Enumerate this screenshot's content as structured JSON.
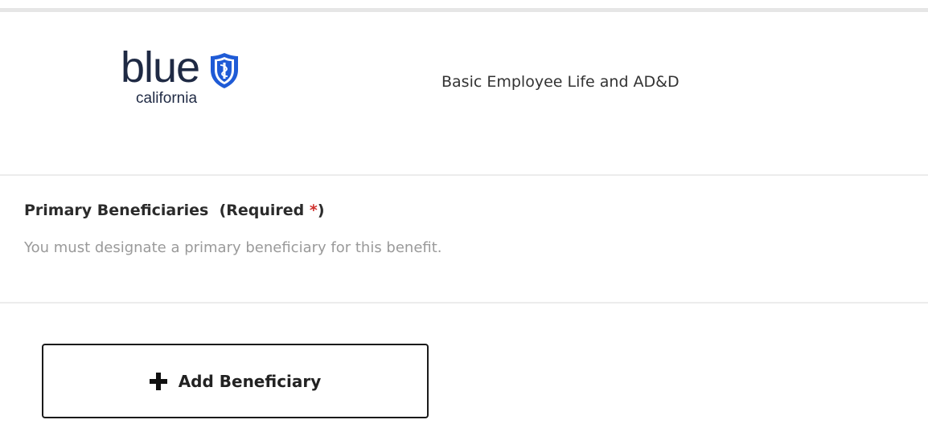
{
  "plan": {
    "logo": {
      "word": "blue",
      "sub": "california",
      "brand_color": "#1f5bd6"
    },
    "name": "Basic Employee Life and AD&D"
  },
  "beneficiaries": {
    "title": "Primary Beneficiaries",
    "required_open": "(Required ",
    "required_star": "*",
    "required_close": ")",
    "help_text": "You must designate a primary beneficiary for this benefit."
  },
  "actions": {
    "add_beneficiary_label": "Add Beneficiary",
    "add_icon": "plus-icon"
  },
  "colors": {
    "required": "#d0312d",
    "help_text": "#9a9a9a",
    "divider": "#ececec"
  }
}
